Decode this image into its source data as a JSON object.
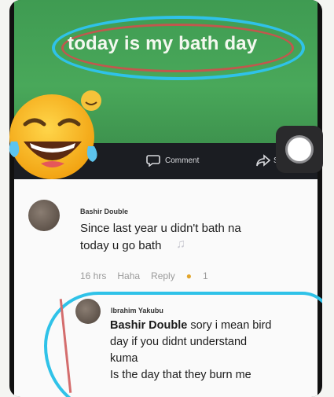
{
  "post": {
    "text": "today is my bath day"
  },
  "actions": {
    "comment_label": "Comment",
    "share_label": "Sh"
  },
  "comments": [
    {
      "author": "Bashir Double",
      "text_line1": "Since last year u didn't bath na",
      "text_line2": "today u go bath",
      "time": "16 hrs",
      "haha": "Haha",
      "reply": "Reply",
      "reaction_count": "1"
    }
  ],
  "reply": {
    "author": "Ibrahim Yakubu",
    "mention": "Bashir Double",
    "line1": " sory i mean bird",
    "line2": "day if you didnt understand",
    "line3": "kuma",
    "line4": "Is the day that they burn me"
  },
  "colors": {
    "highlight_blue": "#2fc2e8",
    "highlight_red": "#c2574d",
    "post_green": "#49a85a"
  }
}
